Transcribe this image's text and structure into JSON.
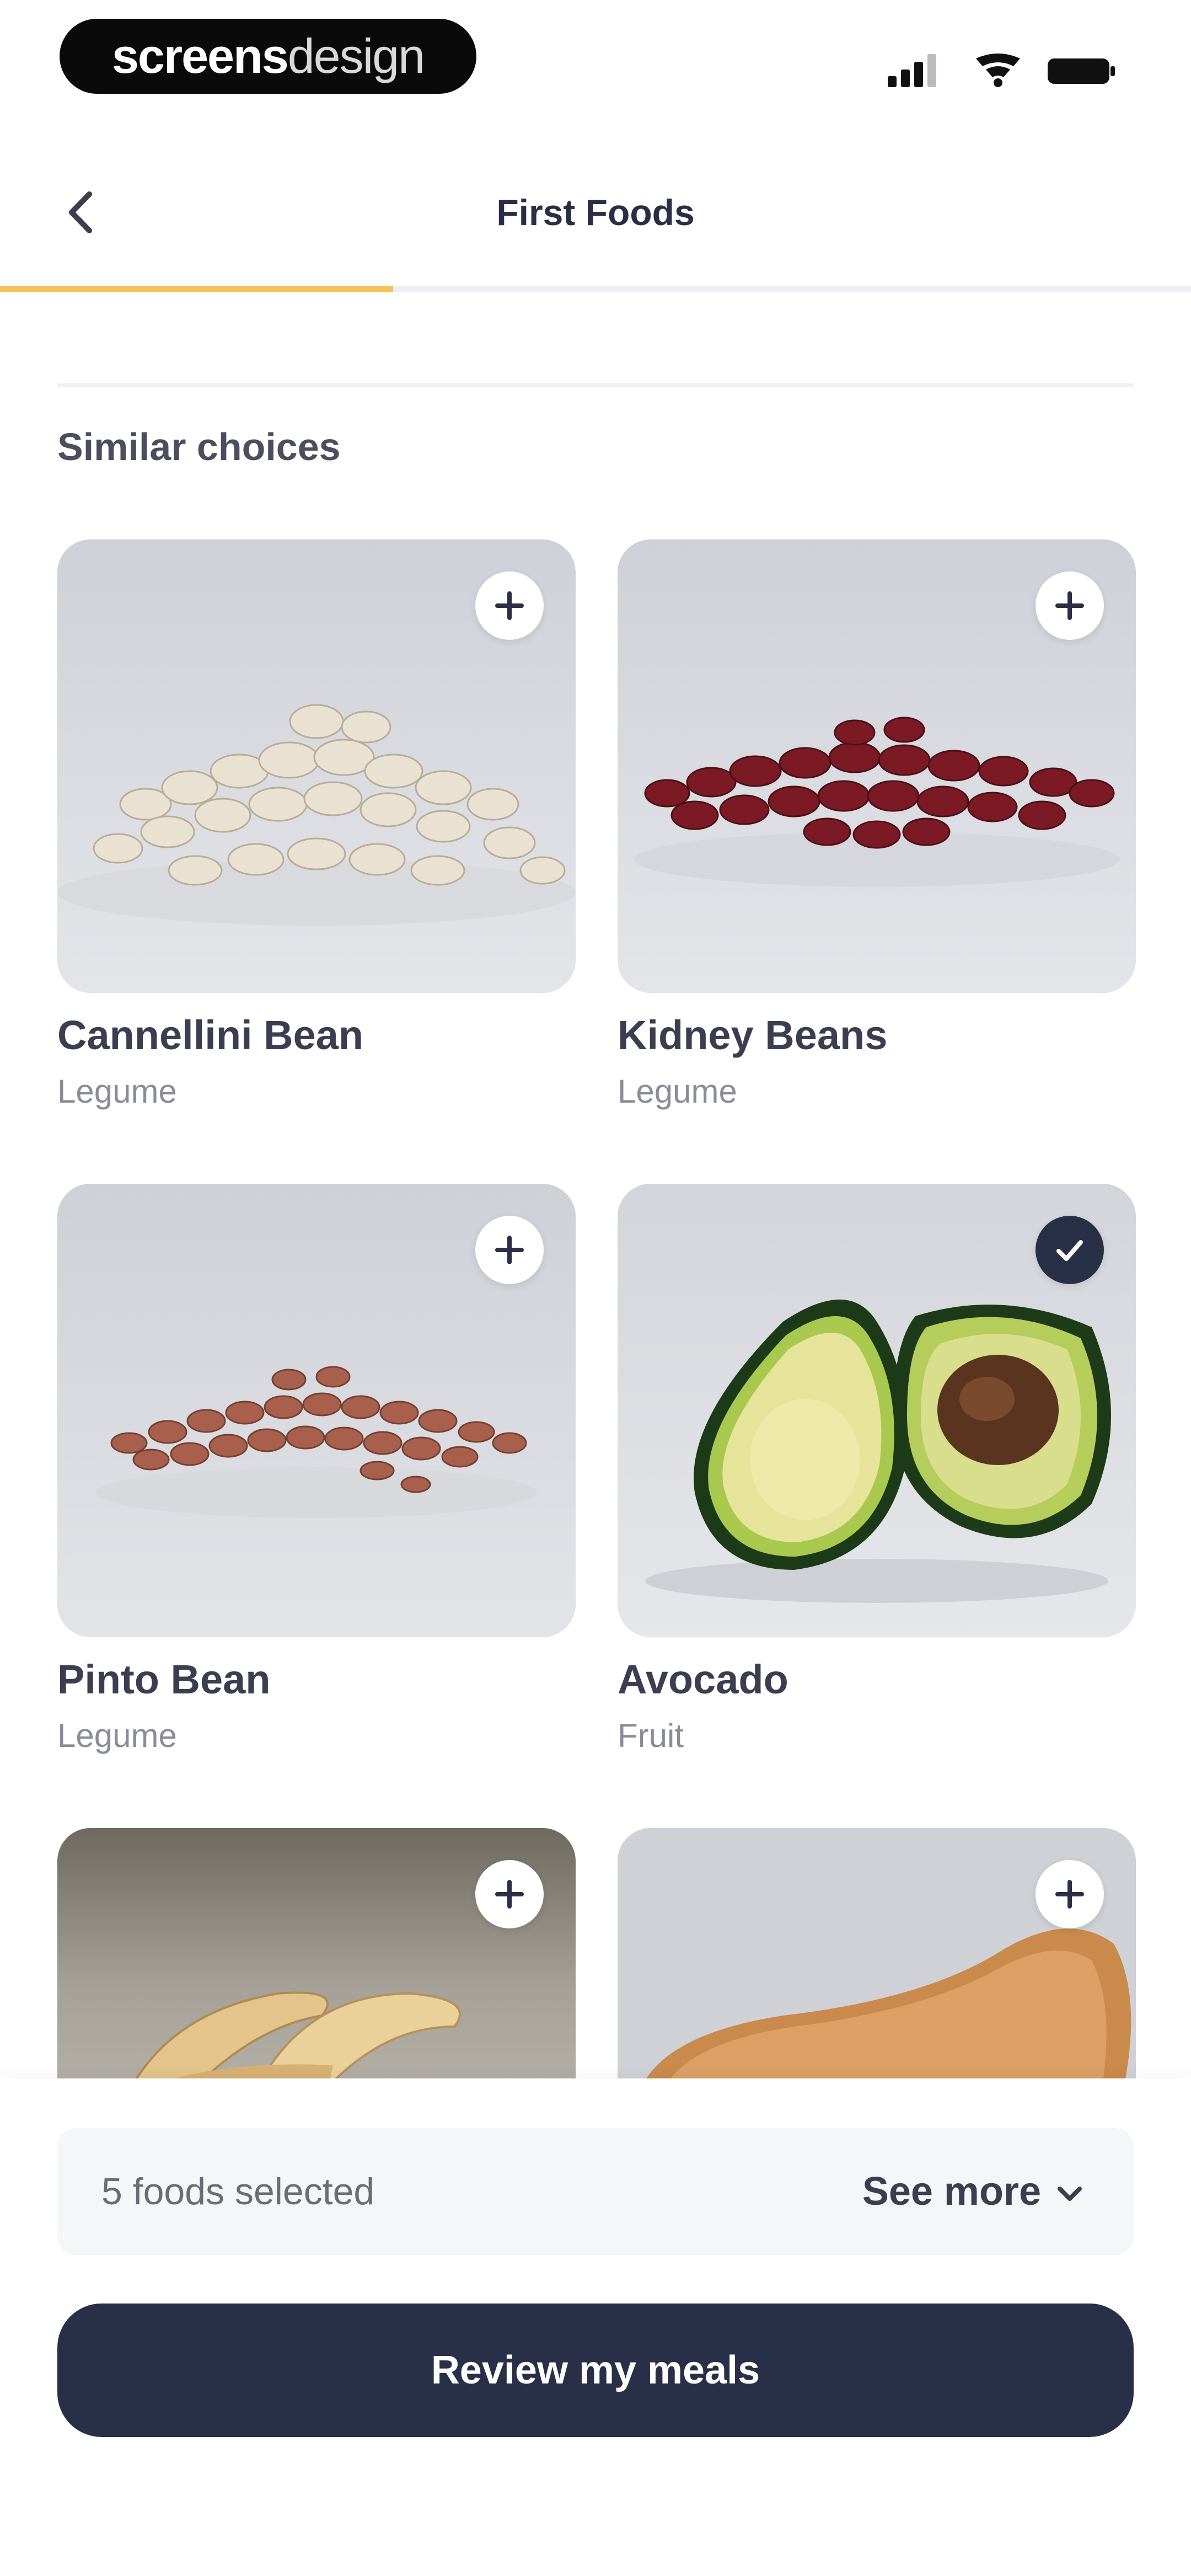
{
  "status_bar": {
    "brand_bold": "screens",
    "brand_light": "design"
  },
  "nav": {
    "title": "First Foods",
    "progress": 0.33
  },
  "section": {
    "title": "Similar choices"
  },
  "foods": [
    {
      "name": "Cannellini Bean",
      "category": "Legume",
      "selected": false,
      "icon": "plus-icon"
    },
    {
      "name": "Kidney Beans",
      "category": "Legume",
      "selected": false,
      "icon": "plus-icon"
    },
    {
      "name": "Pinto Bean",
      "category": "Legume",
      "selected": false,
      "icon": "plus-icon"
    },
    {
      "name": "Avocado",
      "category": "Fruit",
      "selected": true,
      "icon": "check-icon"
    },
    {
      "name": "",
      "category": "",
      "selected": false,
      "icon": "plus-icon"
    },
    {
      "name": "",
      "category": "",
      "selected": false,
      "icon": "plus-icon"
    }
  ],
  "footer": {
    "selected_count": "5 foods selected",
    "see_more": "See more",
    "review_button": "Review my meals"
  },
  "colors": {
    "accent": "#f5c15a",
    "primary": "#2a2f48"
  }
}
